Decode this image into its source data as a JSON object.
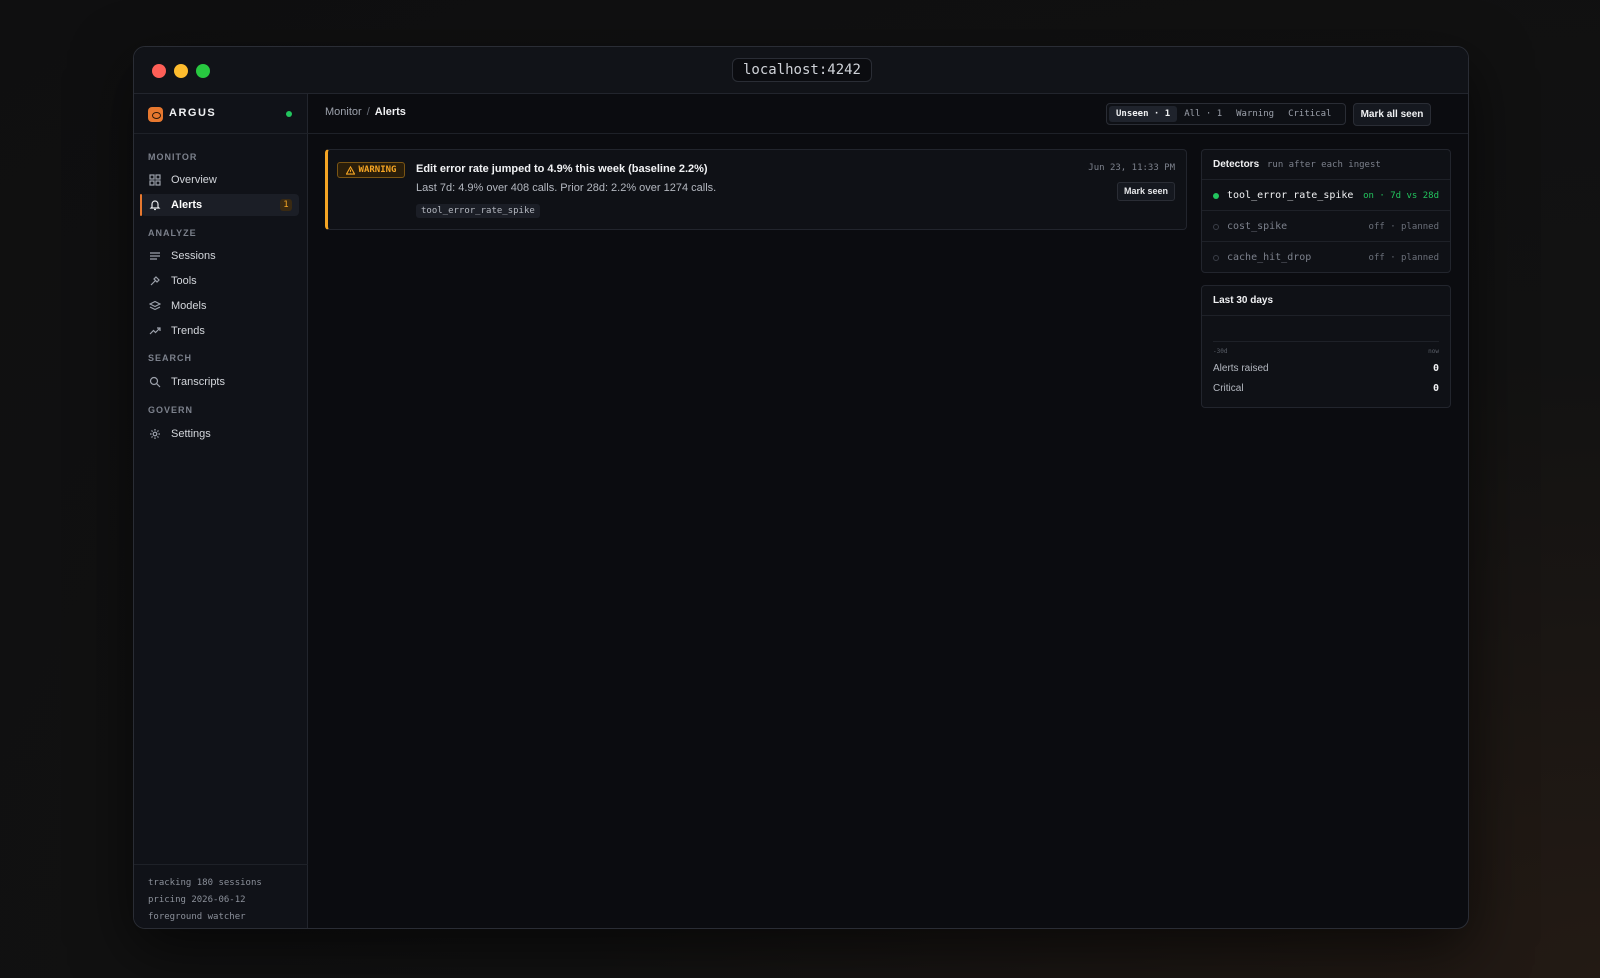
{
  "window": {
    "url": "localhost:4242"
  },
  "brand": {
    "name": "ARGUS"
  },
  "sidebar": {
    "sections": [
      {
        "title": "MONITOR",
        "items": [
          {
            "label": "Overview",
            "icon": "grid-icon"
          },
          {
            "label": "Alerts",
            "icon": "bell-icon",
            "badge": "1",
            "active": true
          }
        ]
      },
      {
        "title": "ANALYZE",
        "items": [
          {
            "label": "Sessions",
            "icon": "list-icon"
          },
          {
            "label": "Tools",
            "icon": "tool-icon"
          },
          {
            "label": "Models",
            "icon": "layers-icon"
          },
          {
            "label": "Trends",
            "icon": "trend-icon"
          }
        ]
      },
      {
        "title": "SEARCH",
        "items": [
          {
            "label": "Transcripts",
            "icon": "search-icon"
          }
        ]
      },
      {
        "title": "GOVERN",
        "items": [
          {
            "label": "Settings",
            "icon": "gear-icon"
          }
        ]
      }
    ],
    "footer": [
      "tracking 180 sessions",
      "pricing 2026-06-12",
      "foreground watcher"
    ]
  },
  "header": {
    "breadcrumb": {
      "parent": "Monitor",
      "separator": "/",
      "current": "Alerts"
    },
    "filters": [
      {
        "label": "Unseen · 1",
        "active": true
      },
      {
        "label": "All · 1",
        "active": false
      },
      {
        "label": "Warning",
        "active": false
      },
      {
        "label": "Critical",
        "active": false
      }
    ],
    "mark_all_label": "Mark all seen"
  },
  "alert": {
    "severity": "WARNING",
    "title": "Edit error rate jumped to 4.9% this week (baseline 2.2%)",
    "description": "Last 7d: 4.9% over 408 calls. Prior 28d: 2.2% over 1274 calls.",
    "tag": "tool_error_rate_spike",
    "time": "Jun 23, 11:33 PM",
    "mark_seen_label": "Mark seen"
  },
  "detectors": {
    "title": "Detectors",
    "subtitle": "run after each ingest",
    "rows": [
      {
        "name": "tool_error_rate_spike",
        "status": "on · 7d vs 28d",
        "on": true
      },
      {
        "name": "cost_spike",
        "status": "off · planned",
        "on": false
      },
      {
        "name": "cache_hit_drop",
        "status": "off · planned",
        "on": false
      }
    ]
  },
  "stats": {
    "title": "Last 30 days",
    "axis_start": "-30d",
    "axis_end": "now",
    "rows": [
      {
        "label": "Alerts raised",
        "value": "0"
      },
      {
        "label": "Critical",
        "value": "0"
      }
    ]
  },
  "colors": {
    "accent": "#e7782f",
    "warning": "#f5a524",
    "success": "#22c55e"
  }
}
